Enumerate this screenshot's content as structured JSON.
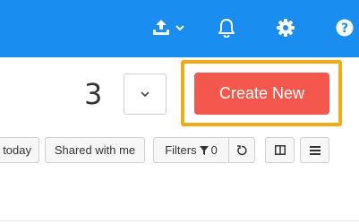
{
  "topbar": {
    "bg_color": "#1a8ef0",
    "icons": [
      "upload-icon",
      "chevron-down-icon",
      "bell-icon",
      "gear-icon",
      "help-icon"
    ],
    "help_glyph": "?"
  },
  "main": {
    "count": "3",
    "create_button_label": "Create New",
    "create_button_color": "#f4584c",
    "highlight_color": "#f2ab12"
  },
  "toolbar": {
    "today_label": "today",
    "shared_label": "Shared with me",
    "filters_label": "Filters",
    "filters_count": "0"
  }
}
